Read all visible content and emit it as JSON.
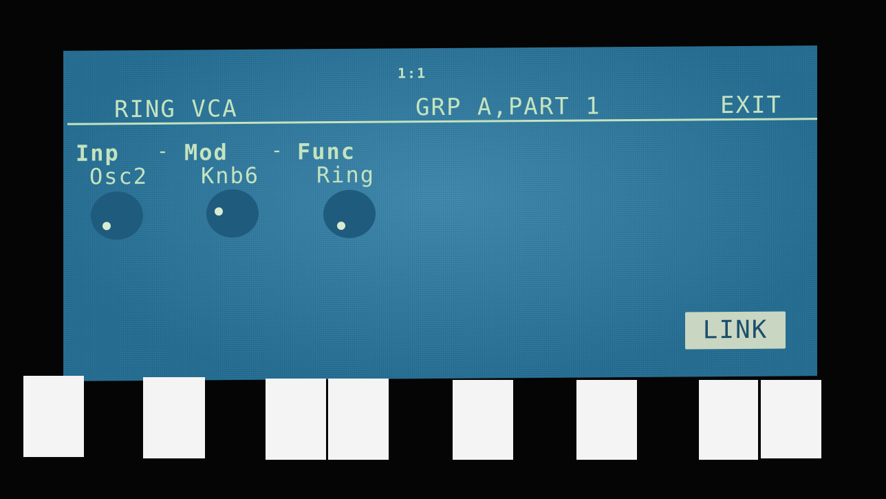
{
  "header": {
    "position": "1:1",
    "title": "RING VCA",
    "group": "GRP A,PART 1",
    "exit_label": "EXIT"
  },
  "params": [
    {
      "label": "Inp",
      "value": "Osc2"
    },
    {
      "label": "Mod",
      "value": "Knb6"
    },
    {
      "label": "Func",
      "value": "Ring"
    }
  ],
  "separators": [
    "-",
    "-"
  ],
  "link_label": "LINK",
  "icons": [
    "knob-icon"
  ],
  "colors": {
    "screen": "#2c7ea8",
    "text": "#c4e3bf",
    "knob": "#1f5b7c",
    "link_bg": "#c9d7c2"
  },
  "keyboard": [
    "white",
    "black",
    "white",
    "black",
    "white",
    "white",
    "black",
    "white",
    "black",
    "white",
    "black",
    "white",
    "white"
  ]
}
